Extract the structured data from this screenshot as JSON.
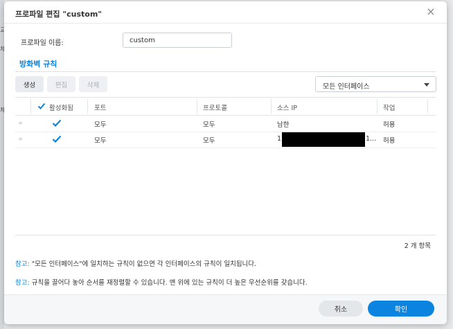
{
  "background": {
    "fragments": [
      "교",
      "체",
      "체"
    ]
  },
  "dialog": {
    "title": "프로파일 편집 \"custom\"",
    "close_symbol": "×",
    "profile_name_label": "프로파일 이름:",
    "profile_name_value": "custom",
    "section_title": "방화벽 규칙"
  },
  "toolbar": {
    "create_label": "생성",
    "edit_label": "편집",
    "delete_label": "삭제",
    "interface_selected": "모든 인터페이스"
  },
  "table": {
    "headers": {
      "enabled": "활성화됨",
      "port": "포트",
      "protocol": "프로토콜",
      "source_ip": "소스 IP",
      "action": "작업"
    },
    "rows": [
      {
        "enabled": true,
        "port": "모두",
        "protocol": "모두",
        "source_ip": "남한",
        "action": "허용"
      },
      {
        "enabled": true,
        "port": "모두",
        "protocol": "모두",
        "source_ip_prefix": "1",
        "source_ip_suffix": "1...",
        "action": "허용"
      }
    ],
    "count": "2 개 항목"
  },
  "notes": [
    {
      "label": "참고:",
      "text": "\"모든 인터페이스\"에 일치하는 규칙이 없으면 각 인터페이스의 규칙이 일치됩니다."
    },
    {
      "label": "참고:",
      "text": "규칙을 끌어다 놓아 순서를 재정렬할 수 있습니다. 맨 위에 있는 규칙이 더 높은 우선순위를 갖습니다."
    }
  ],
  "footer": {
    "cancel_label": "취소",
    "ok_label": "확인"
  },
  "colors": {
    "accent": "#0b84e0",
    "check": "#0b84e0",
    "redaction": "#000000"
  }
}
